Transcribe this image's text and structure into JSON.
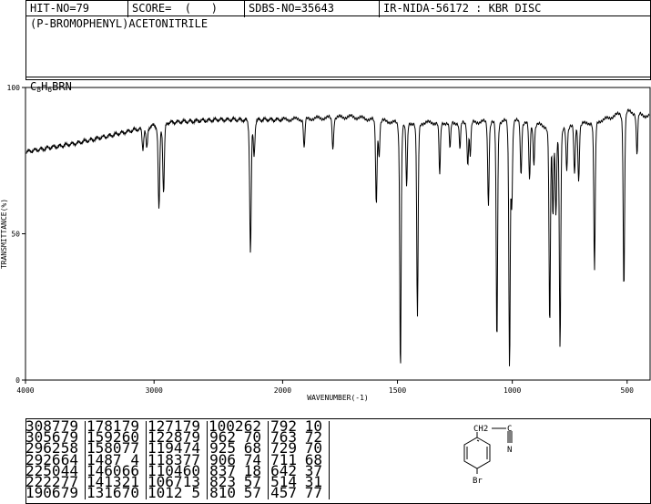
{
  "header": {
    "hit_no": "HIT-NO=79",
    "score": "SCORE=  (   )",
    "sdbs_no": "SDBS-NO=35643",
    "ir_info": "IR-NIDA-56172 : KBR DISC"
  },
  "compound": {
    "name": "(P-BROMOPHENYL)ACETONITRILE",
    "formula_parts": [
      "C",
      "8",
      "H",
      "6",
      "BRN"
    ]
  },
  "chart_data": {
    "type": "line",
    "title": "",
    "xlabel": "WAVENUMBER(-1)",
    "ylabel": "TRANSMITTANCE(%)",
    "xlim": [
      4000,
      400
    ],
    "ylim": [
      0,
      100
    ],
    "x_ticks": [
      "4000",
      "3000",
      "2000",
      "1500",
      "1000",
      "500"
    ],
    "y_ticks": [
      "100",
      "50",
      "0"
    ],
    "baseline": [
      [
        4000,
        78
      ],
      [
        3600,
        81
      ],
      [
        3300,
        84
      ],
      [
        3100,
        86
      ],
      [
        2900,
        88
      ],
      [
        2500,
        89
      ],
      [
        2000,
        89
      ],
      [
        1700,
        90
      ],
      [
        1500,
        88
      ],
      [
        1200,
        88
      ],
      [
        1000,
        89
      ],
      [
        800,
        86
      ],
      [
        600,
        89
      ],
      [
        500,
        92
      ],
      [
        400,
        90
      ]
    ],
    "peaks": [
      {
        "x": 3087,
        "t": 79
      },
      {
        "x": 3056,
        "t": 79
      },
      {
        "x": 2962,
        "t": 58
      },
      {
        "x": 2926,
        "t": 64
      },
      {
        "x": 2250,
        "t": 44
      },
      {
        "x": 2222,
        "t": 77
      },
      {
        "x": 1906,
        "t": 79
      },
      {
        "x": 1781,
        "t": 79
      },
      {
        "x": 1592,
        "t": 60
      },
      {
        "x": 1580,
        "t": 77
      },
      {
        "x": 1487,
        "t": 4
      },
      {
        "x": 1460,
        "t": 66
      },
      {
        "x": 1413,
        "t": 21
      },
      {
        "x": 1316,
        "t": 70
      },
      {
        "x": 1271,
        "t": 79
      },
      {
        "x": 1228,
        "t": 79
      },
      {
        "x": 1194,
        "t": 74
      },
      {
        "x": 1183,
        "t": 77
      },
      {
        "x": 1104,
        "t": 60
      },
      {
        "x": 1067,
        "t": 13
      },
      {
        "x": 1012,
        "t": 5
      },
      {
        "x": 1002,
        "t": 62
      },
      {
        "x": 962,
        "t": 70
      },
      {
        "x": 925,
        "t": 68
      },
      {
        "x": 906,
        "t": 74
      },
      {
        "x": 837,
        "t": 18
      },
      {
        "x": 823,
        "t": 57
      },
      {
        "x": 810,
        "t": 57
      },
      {
        "x": 792,
        "t": 10
      },
      {
        "x": 763,
        "t": 72
      },
      {
        "x": 729,
        "t": 70
      },
      {
        "x": 711,
        "t": 68
      },
      {
        "x": 642,
        "t": 37
      },
      {
        "x": 514,
        "t": 31
      },
      {
        "x": 457,
        "t": 77
      }
    ]
  },
  "peak_table": [
    [
      [
        "3087",
        "79"
      ],
      [
        "3056",
        "79"
      ],
      [
        "2962",
        "58"
      ],
      [
        "2926",
        "64"
      ],
      [
        "2250",
        "44"
      ],
      [
        "2222",
        "77"
      ],
      [
        "1906",
        "79"
      ]
    ],
    [
      [
        "1781",
        "79"
      ],
      [
        "1592",
        "60"
      ],
      [
        "1580",
        "77"
      ],
      [
        "1487",
        "4"
      ],
      [
        "1460",
        "66"
      ],
      [
        "1413",
        "21"
      ],
      [
        "1316",
        "70"
      ]
    ],
    [
      [
        "1271",
        "79"
      ],
      [
        "1228",
        "79"
      ],
      [
        "1194",
        "74"
      ],
      [
        "1183",
        "77"
      ],
      [
        "1104",
        "60"
      ],
      [
        "1067",
        "13"
      ],
      [
        "1012",
        "5"
      ]
    ],
    [
      [
        "1002",
        "62"
      ],
      [
        "962",
        "70"
      ],
      [
        "925",
        "68"
      ],
      [
        "906",
        "74"
      ],
      [
        "837",
        "18"
      ],
      [
        "823",
        "57"
      ],
      [
        "810",
        "57"
      ]
    ],
    [
      [
        "792",
        "10"
      ],
      [
        "763",
        "72"
      ],
      [
        "729",
        "70"
      ],
      [
        "711",
        "68"
      ],
      [
        "642",
        "37"
      ],
      [
        "514",
        "31"
      ],
      [
        "457",
        "77"
      ]
    ]
  ],
  "structure": {
    "ch2_label": "CH2",
    "c_label": "C",
    "n_label": "N",
    "br_label": "Br"
  }
}
